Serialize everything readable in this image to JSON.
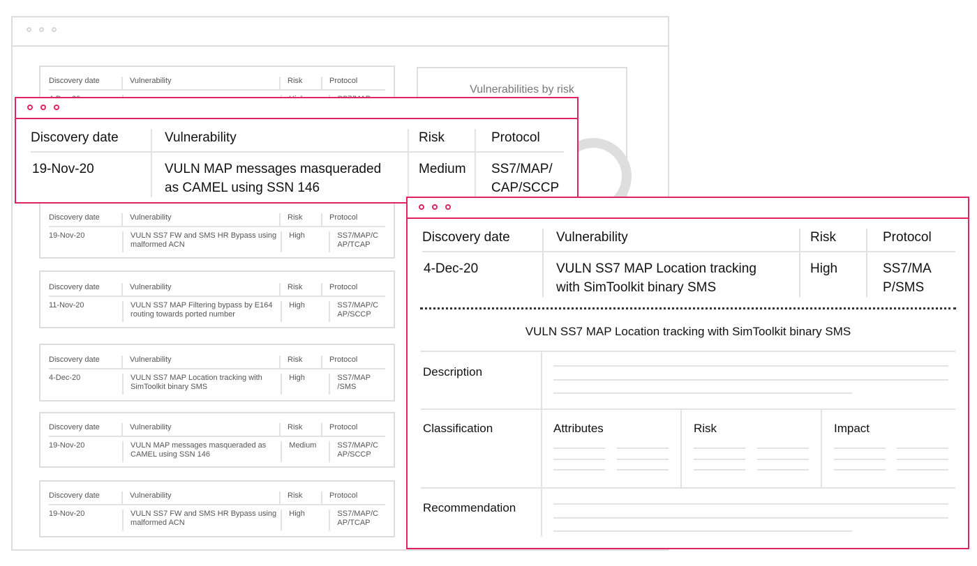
{
  "headers": {
    "date": "Discovery date",
    "vuln": "Vulnerability",
    "risk": "Risk",
    "protocol": "Protocol"
  },
  "background_list": [
    {
      "date": "4-Dec-20",
      "vuln": "",
      "risk": "High",
      "protocol": "SS7/MAP"
    },
    {
      "date": "19-Nov-20",
      "vuln": "VULN SS7 FW and SMS HR Bypass using malformed ACN",
      "risk": "High",
      "protocol": "SS7/MAP/C AP/TCAP"
    },
    {
      "date": "11-Nov-20",
      "vuln": "VULN SS7 MAP Filtering bypass by E164 routing towards ported number",
      "risk": "High",
      "protocol": "SS7/MAP/C AP/SCCP"
    },
    {
      "date": "4-Dec-20",
      "vuln": "VULN SS7 MAP Location tracking with SimToolkit binary SMS",
      "risk": "High",
      "protocol": "SS7/MAP /SMS"
    },
    {
      "date": "19-Nov-20",
      "vuln": "VULN MAP messages masqueraded as CAMEL using SSN 146",
      "risk": "Medium",
      "protocol": "SS7/MAP/C AP/SCCP"
    },
    {
      "date": "19-Nov-20",
      "vuln": "VULN SS7 FW and SMS HR Bypass using malformed ACN",
      "risk": "High",
      "protocol": "SS7/MAP/C AP/TCAP"
    }
  ],
  "chart_panel": {
    "title": "Vulnerabilities by risk"
  },
  "popup1": {
    "date": "19-Nov-20",
    "vuln": "VULN MAP messages masqueraded as CAMEL using SSN 146",
    "risk": "Medium",
    "protocol": "SS7/MAP/ CAP/SCCP"
  },
  "popup2": {
    "date": "4-Dec-20",
    "vuln": "VULN SS7 MAP Location tracking with SimToolkit binary SMS",
    "risk": "High",
    "protocol": "SS7/MA P/SMS",
    "detail_title": "VULN SS7 MAP Location tracking with SimToolkit binary SMS",
    "description_label": "Description",
    "classification_label": "Classification",
    "attributes_label": "Attributes",
    "risk_label": "Risk",
    "impact_label": "Impact",
    "recommendation_label": "Recommendation"
  }
}
